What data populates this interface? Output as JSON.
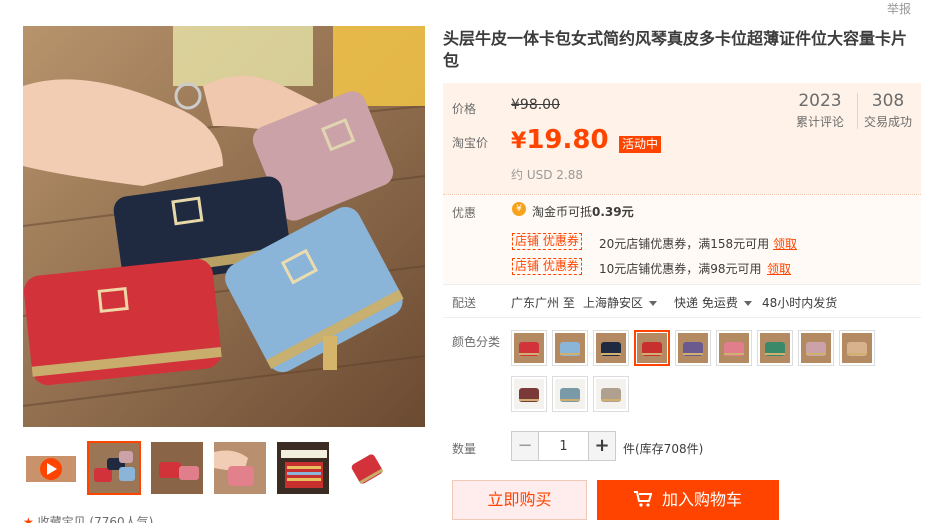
{
  "report_label": "举报",
  "title": "头层牛皮一体卡包女式简约风琴真皮多卡位超薄证件位大容量卡片包",
  "price": {
    "label": "价格",
    "original": "¥98.00",
    "taobao_label": "淘宝价",
    "currency_symbol": "¥",
    "taobao_price": "19.80",
    "promo_tag": "活动中",
    "usd": "约 USD 2.88"
  },
  "stats": [
    {
      "number": "2023",
      "label": "累计评论"
    },
    {
      "number": "308",
      "label": "交易成功"
    }
  ],
  "offers": {
    "label": "优惠",
    "coin_text": "淘金币可抵",
    "coin_amount": "0.39元",
    "coupons": [
      {
        "tag": "店铺 优惠券",
        "desc": "20元店铺优惠券，满158元可用",
        "get": "领取"
      },
      {
        "tag": "店铺 优惠券",
        "desc": "10元店铺优惠券，满98元可用",
        "get": "领取"
      }
    ]
  },
  "shipping": {
    "label": "配送",
    "from": "广东广州 至",
    "to": "上海静安区",
    "method": "快递 免运费",
    "dispatch": "48小时内发货"
  },
  "color": {
    "label": "颜色分类",
    "selected_index": 3,
    "count": 12
  },
  "quantity": {
    "label": "数量",
    "value": "1",
    "minus": "−",
    "plus": "+",
    "stock": "件(库存708件)"
  },
  "buttons": {
    "buy_now": "立即购买",
    "add_cart": "加入购物车"
  },
  "favorite": "收藏宝贝 (7760人气)",
  "colors": {
    "accent": "#ff4400",
    "price_bg": "#fff2e8"
  }
}
